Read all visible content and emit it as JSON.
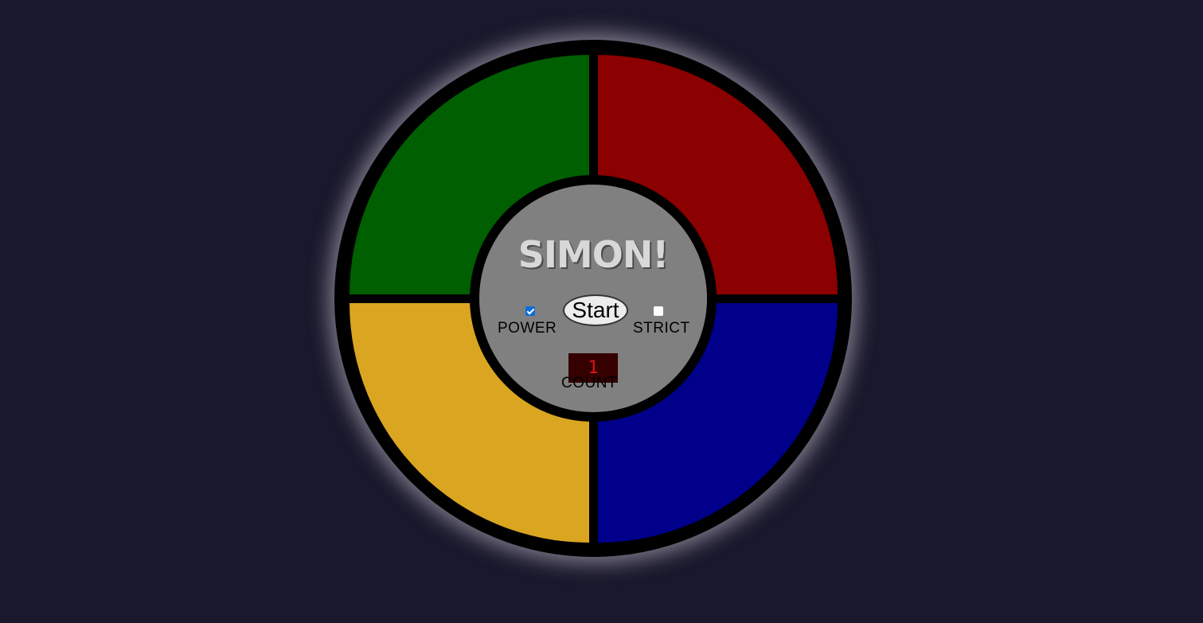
{
  "game": {
    "title": "SIMON!",
    "start_label": "Start",
    "power_label": "POWER",
    "strict_label": "STRICT",
    "count_label": "COUNT",
    "count_value": "1",
    "power_on": true,
    "strict_on": false
  },
  "colors": {
    "background": "#1a182c",
    "green_pad": "#005f00",
    "red_pad": "#8b0000",
    "yellow_pad": "#daa521",
    "blue_pad": "#00008b",
    "center": "#808080",
    "count_bg": "#340000",
    "count_text": "#dc1414"
  }
}
